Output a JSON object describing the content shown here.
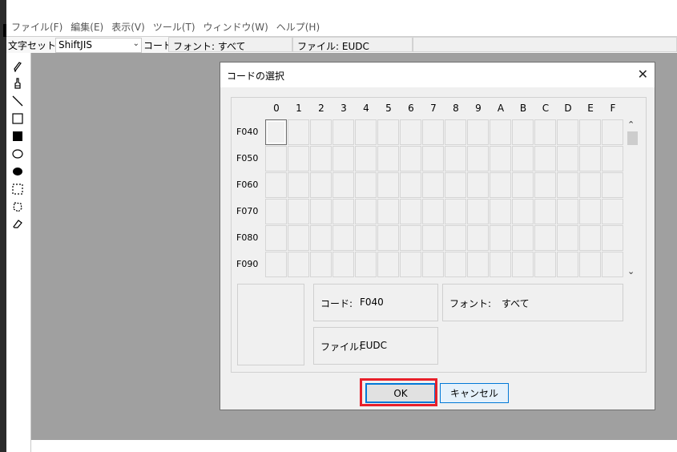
{
  "menu": [
    "ファイル(F)",
    "編集(E)",
    "表示(V)",
    "ツール(T)",
    "ウィンドウ(W)",
    "ヘルプ(H)"
  ],
  "toolbar": {
    "charset_label": "文字セット:",
    "charset_value": "ShiftJIS",
    "code_label": "コード:",
    "font_label": "フォント: すべて",
    "file_label": "ファイル: EUDC"
  },
  "tools": [
    "pencil-icon",
    "brush-icon",
    "line-icon",
    "rectangle-outline-icon",
    "rectangle-filled-icon",
    "ellipse-outline-icon",
    "ellipse-filled-icon",
    "rect-select-icon",
    "freeform-select-icon",
    "eraser-icon"
  ],
  "dialog": {
    "title": "コードの選択",
    "columns": [
      "0",
      "1",
      "2",
      "3",
      "4",
      "5",
      "6",
      "7",
      "8",
      "9",
      "A",
      "B",
      "C",
      "D",
      "E",
      "F"
    ],
    "rows": [
      "F040",
      "F050",
      "F060",
      "F070",
      "F080",
      "F090"
    ],
    "selected": "F040",
    "info": {
      "code_key": "コード:",
      "code_value": "F040",
      "font_key": "フォント:",
      "font_value": "すべて",
      "file_key": "ファイル:",
      "file_value": "EUDC"
    },
    "ok_label": "OK",
    "cancel_label": "キャンセル"
  }
}
